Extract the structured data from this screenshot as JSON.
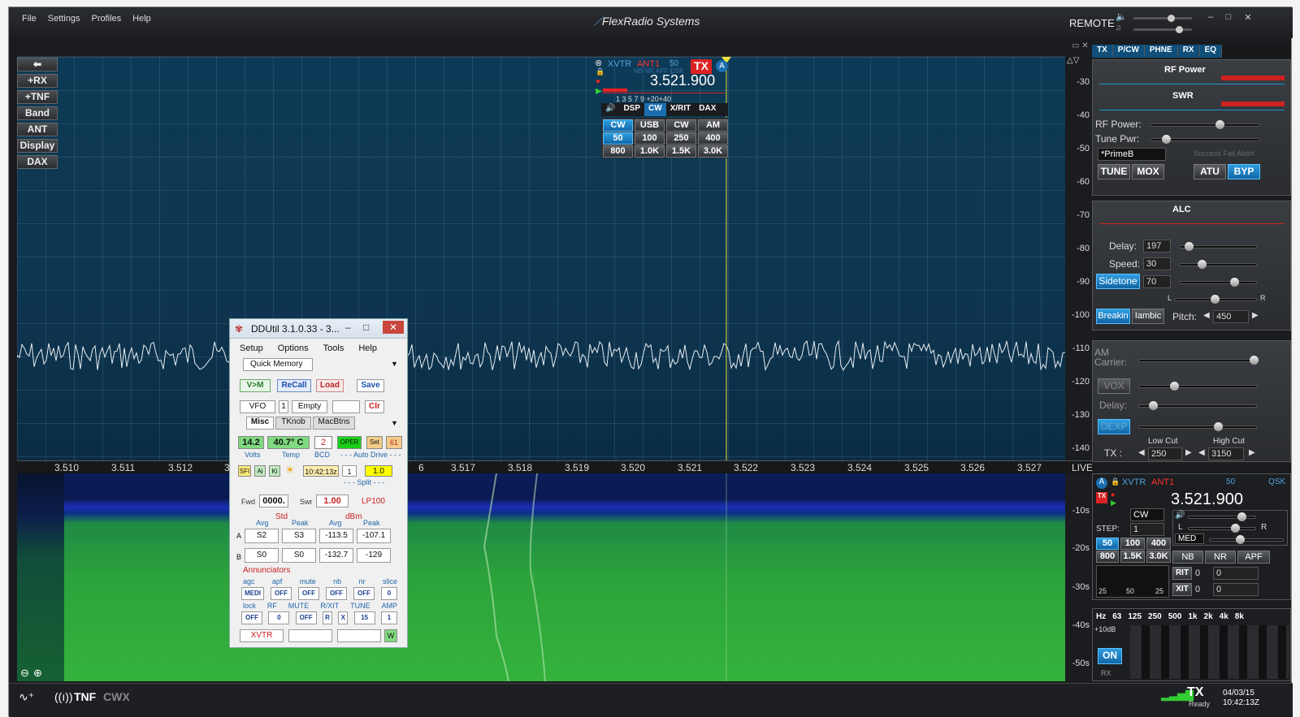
{
  "menu": [
    "File",
    "Settings",
    "Profiles",
    "Help"
  ],
  "app_title": "FlexRadio Systems",
  "remote": "REMOTE",
  "window_controls": {
    "minimize": "–",
    "maximize": "□",
    "close": "✕"
  },
  "left_buttons": [
    "+RX",
    "+TNF",
    "Band",
    "ANT",
    "Display",
    "DAX"
  ],
  "db_scale": [
    "-30",
    "-40",
    "-50",
    "-60",
    "-70",
    "-80",
    "-90",
    "-100",
    "-110",
    "-120",
    "-130",
    "-140"
  ],
  "freq_axis": [
    "3.510",
    "3.511",
    "3.512",
    "3.5",
    "6",
    "3.517",
    "3.518",
    "3.519",
    "3.520",
    "3.521",
    "3.522",
    "3.523",
    "3.524",
    "3.525",
    "3.526",
    "3.527"
  ],
  "live": "LIVE",
  "wf_scale": [
    "-10s",
    "-20s",
    "-30s",
    "-40s",
    "-50s"
  ],
  "slice_flag": {
    "xvtr": "XVTR",
    "ant": "ANT1",
    "val": "50",
    "tx": "TX",
    "flags": "NB NR APF QSK",
    "freq": "3.521.900",
    "scale": "1   3   5   7   9  +20+40",
    "tabs": [
      "DSP",
      "CW",
      "X/RIT",
      "DAX"
    ],
    "modes": [
      "CW",
      "USB",
      "CW",
      "AM"
    ],
    "filters": [
      "50",
      "100",
      "250",
      "400",
      "800",
      "1.0K",
      "1.5K",
      "3.0K"
    ]
  },
  "right_tabs": [
    "TX",
    "P/CW",
    "PHNE",
    "RX",
    "EQ"
  ],
  "tx_panel": {
    "rf_power_meter": "RF Power",
    "swr_meter": "SWR",
    "rf_power": "RF Power:",
    "tune_pwr": "Tune Pwr:",
    "profile": "*PrimeB",
    "atu_status": "Success Fail Abort",
    "tune": "TUNE",
    "mox": "MOX",
    "atu": "ATU",
    "byp": "BYP"
  },
  "cw_panel": {
    "alc": "ALC",
    "delay": "Delay:",
    "delay_val": "197",
    "speed": "Speed:",
    "speed_val": "30",
    "sidetone": "Sidetone",
    "sidetone_val": "70",
    "l": "L",
    "r": "R",
    "breakin": "Breakin",
    "iambic": "Iambic",
    "pitch": "Pitch:",
    "pitch_val": "450"
  },
  "ph_panel": {
    "am_carrier": "AM Carrier:",
    "vox": "VOX",
    "delay": "Delay:",
    "dexp": "DEXP",
    "low_cut": "Low Cut",
    "high_cut": "High Cut",
    "tx": "TX :",
    "low_val": "250",
    "high_val": "3150"
  },
  "rx_panel": {
    "xvtr": "XVTR",
    "ant": "ANT1",
    "val": "50",
    "qsk": "QSK",
    "freq": "3.521.900",
    "mode": "CW",
    "step": "STEP:",
    "step_val": "1",
    "filters": [
      "50",
      "100",
      "400",
      "800",
      "1.5K",
      "3.0K"
    ],
    "agc": "MED",
    "nb": "NB",
    "nr": "NR",
    "apf": "APF",
    "rit": "RIT",
    "xit": "XIT",
    "rit_val": "0",
    "xit_val": "0",
    "rit_off": "0",
    "xit_off": "0",
    "l": "L",
    "r": "R",
    "filt": [
      "25",
      "50",
      "25"
    ]
  },
  "eq_panel": {
    "hz": "Hz",
    "bands": [
      "63",
      "125",
      "250",
      "500",
      "1k",
      "2k",
      "4k",
      "8k"
    ],
    "gain": "+10dB",
    "on": "ON",
    "rx": "RX"
  },
  "status": {
    "tnf": "TNF",
    "cwx": "CWX",
    "tx": "TX",
    "ready": "Ready",
    "date": "04/03/15",
    "time": "10:42:13Z"
  },
  "ddutil": {
    "title": "DDUtil 3.1.0.33 - 3...",
    "menu": [
      "Setup",
      "Options",
      "Tools",
      "Help"
    ],
    "qm_tab": "Quick Memory",
    "vm": "V>M",
    "recall": "ReCall",
    "load": "Load",
    "save": "Save",
    "vfo": "VFO",
    "slot": "1",
    "empty": "Empty",
    "clr": "Clr",
    "tabs": [
      "Misc",
      "TKnob",
      "MacBtns"
    ],
    "volts": "14.2",
    "temp": "40.7° C",
    "bcd": "2",
    "oper": "OPER",
    "set": "Set",
    "n61": "61",
    "volts_l": "Volts",
    "temp_l": "Temp",
    "bcd_l": "BCD",
    "auto": "- - - Auto Drive - - -",
    "sfi": "SFI",
    "ai": "Ai",
    "ki": "Ki",
    "time": "10:42:13z",
    "spin": "1",
    "drive": "1.0",
    "split": "- - - Split - - -",
    "fwd": "Fwd",
    "fwd_val": "0000.",
    "swr": "Swr",
    "swr_val": "1.00",
    "lp": "LP100",
    "std": "Std",
    "dbm": "dBm",
    "avg": "Avg",
    "peak": "Peak",
    "row_a": [
      "A",
      "S2",
      "S3",
      "-113.5",
      "-107.1"
    ],
    "row_b": [
      "B",
      "S0",
      "S0",
      "-132.7",
      "-129"
    ],
    "ann": "Annunciators",
    "ann1": [
      "agc",
      "apf",
      "mute",
      "nb",
      "nr",
      "slice"
    ],
    "ann1v": [
      "MEDI",
      "OFF",
      "OFF",
      "OFF",
      "OFF",
      "0"
    ],
    "ann2": [
      "lock",
      "RF",
      "MUTE",
      "R/XIT",
      "TUNE",
      "AMP"
    ],
    "ann2v": [
      "OFF",
      "0",
      "OFF",
      "R",
      "X",
      "15",
      "1"
    ],
    "xvtr": "XVTR",
    "w": "W"
  }
}
